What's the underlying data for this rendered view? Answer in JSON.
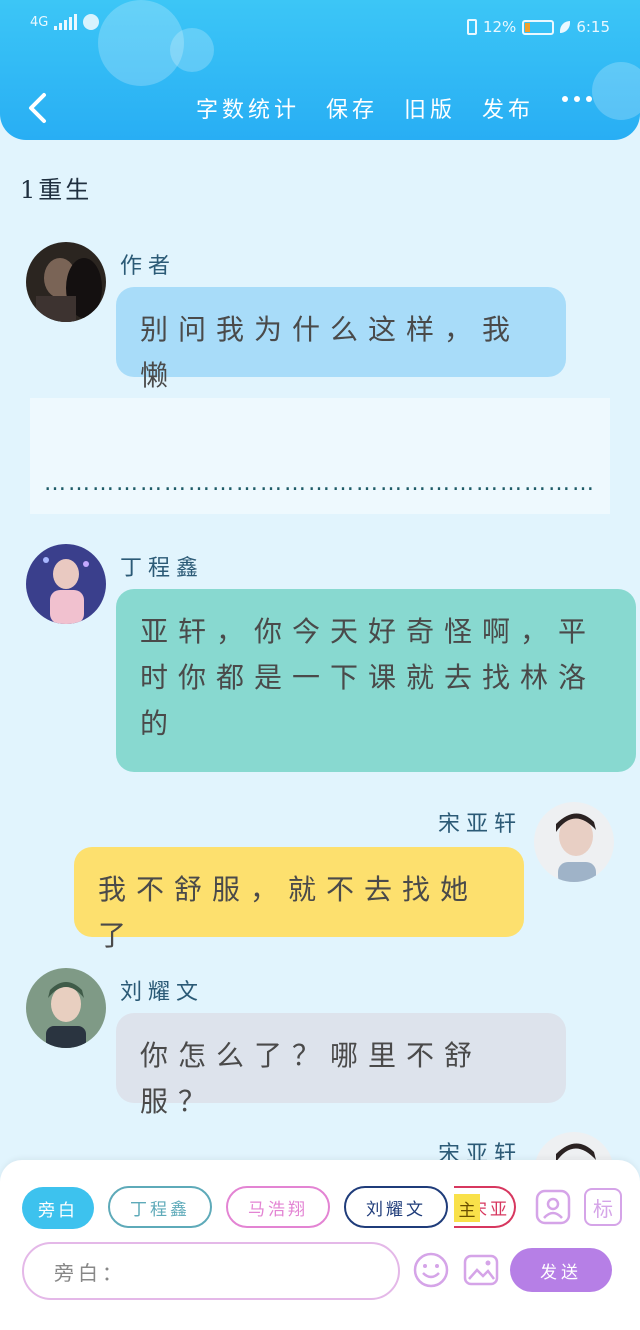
{
  "status_bar": {
    "network": "4G",
    "battery_percent": "12%",
    "battery_level": 0.12,
    "time": "6:15"
  },
  "toolbar": {
    "back_icon": "chevron-left-icon",
    "actions": [
      "字数统计",
      "保存",
      "旧版",
      "发布"
    ],
    "more_icon": "more-dots-icon"
  },
  "story": {
    "chapter_title": "1重生",
    "narration": "……………………………………………………………"
  },
  "messages": [
    {
      "speaker": "作者",
      "text": "别问我为什么这样，我懒",
      "side": "left",
      "color": "#a8dcf9"
    },
    {
      "speaker": "丁程鑫",
      "text": "亚轩，你今天好奇怪啊，平时你都是一下课就去找林洛的",
      "side": "left",
      "color": "#88d9d0"
    },
    {
      "speaker": "宋亚轩",
      "text": "我不舒服，就不去找她了",
      "side": "right",
      "color": "#fde06e"
    },
    {
      "speaker": "刘耀文",
      "text": "你怎么了？哪里不舒服？",
      "side": "left",
      "color": "#dde3ec"
    },
    {
      "speaker": "宋亚轩",
      "text": "",
      "side": "right",
      "color": "#fde06e"
    }
  ],
  "composer": {
    "roles": [
      "旁白",
      "丁程鑫",
      "马浩翔",
      "刘耀文",
      "宋亚"
    ],
    "main_badge": "主",
    "placeholder": "旁白：",
    "send_label": "发送",
    "mark_label": "标",
    "colors": {
      "narration": "#3dc2ee",
      "ding": "#5eaab9",
      "ma": "#e384d3",
      "liu": "#1f3c7a",
      "song": "#d7375f"
    }
  }
}
